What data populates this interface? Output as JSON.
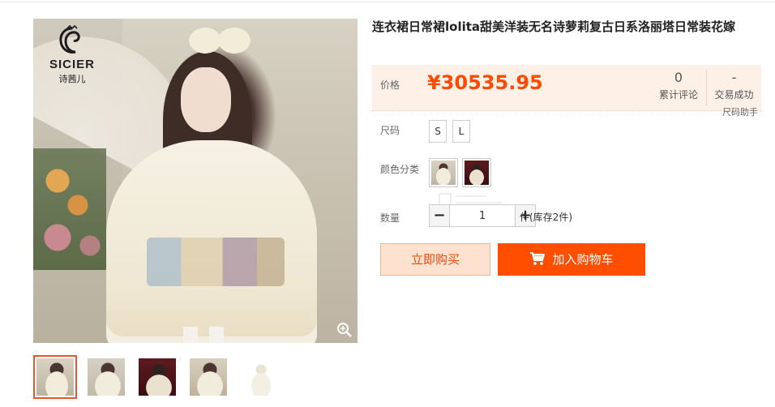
{
  "product": {
    "title": "连衣裙日常裙lolita甜美洋装无名诗萝莉复古日系洛丽塔日常装花嫁",
    "brand": {
      "name": "SICIER",
      "sub": "诗茜儿"
    }
  },
  "price": {
    "label": "价格",
    "value": "¥30535.95",
    "reviews_count": "0",
    "reviews_label": "累计评论",
    "trades_count": "-",
    "trades_label": "交易成功",
    "size_help": "尺码助手"
  },
  "options": {
    "size_label": "尺码",
    "sizes": [
      "S",
      "L"
    ],
    "color_label": "颜色分类"
  },
  "quantity": {
    "label": "数量",
    "minus": "−",
    "plus": "+",
    "value": "1",
    "stock_text": "件(库存2件)"
  },
  "actions": {
    "buy_now": "立即购买",
    "add_to_cart": "加入购物车"
  },
  "colors": {
    "accent": "#ff4e00",
    "price": "#ff4a00",
    "price_bg": "#fdf0e6",
    "thumb_active": "#e4572e"
  },
  "icons": {
    "zoom": "magnifier-icon",
    "cart": "cart-icon"
  }
}
